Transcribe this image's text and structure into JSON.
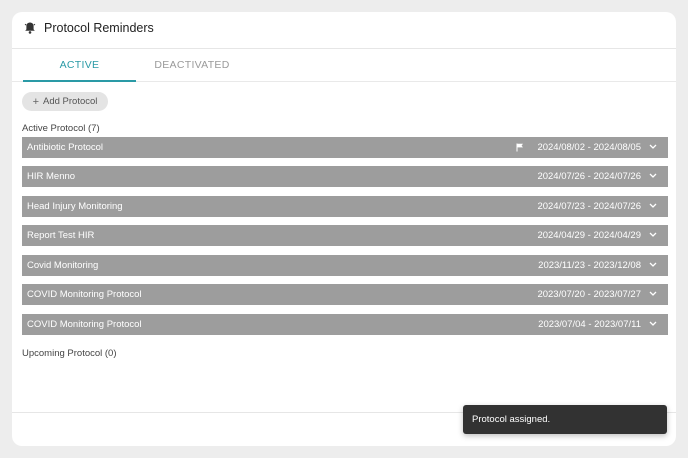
{
  "header": {
    "title": "Protocol Reminders",
    "icon": "bell-icon"
  },
  "tabs": [
    {
      "label": "ACTIVE",
      "selected": true
    },
    {
      "label": "DEACTIVATED",
      "selected": false
    }
  ],
  "add_button": {
    "label": "Add Protocol",
    "icon": "plus-icon"
  },
  "active_section": {
    "label": "Active Protocol (7)",
    "items": [
      {
        "name": "Antibiotic Protocol",
        "dates": "2024/08/02 - 2024/08/05",
        "flagged": true
      },
      {
        "name": "HIR Menno",
        "dates": "2024/07/26 - 2024/07/26",
        "flagged": false
      },
      {
        "name": "Head Injury Monitoring",
        "dates": "2024/07/23 - 2024/07/26",
        "flagged": false
      },
      {
        "name": "Report Test HIR",
        "dates": "2024/04/29 - 2024/04/29",
        "flagged": false
      },
      {
        "name": "Covid Monitoring",
        "dates": "2023/11/23 - 2023/12/08",
        "flagged": false
      },
      {
        "name": "COVID Monitoring Protocol",
        "dates": "2023/07/20 - 2023/07/27",
        "flagged": false
      },
      {
        "name": "COVID Monitoring Protocol",
        "dates": "2023/07/04 - 2023/07/11",
        "flagged": false
      }
    ]
  },
  "upcoming_section": {
    "label": "Upcoming Protocol (0)"
  },
  "toast": {
    "message": "Protocol assigned."
  },
  "colors": {
    "accent": "#2a9aa6",
    "row_background": "#9d9d9d",
    "toast_background": "#323232"
  }
}
